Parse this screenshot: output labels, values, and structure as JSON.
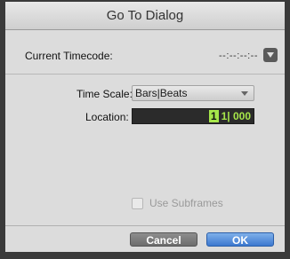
{
  "window": {
    "title": "Go To Dialog"
  },
  "current_timecode": {
    "label": "Current Timecode:",
    "value": "--:--:--:--"
  },
  "time_scale": {
    "label": "Time Scale:",
    "selected": "Bars|Beats"
  },
  "location": {
    "label": "Location:",
    "bar": "1",
    "rest": "1| 000"
  },
  "subframes": {
    "label": "Use Subframes",
    "checked": false
  },
  "buttons": {
    "cancel": "Cancel",
    "ok": "OK"
  }
}
